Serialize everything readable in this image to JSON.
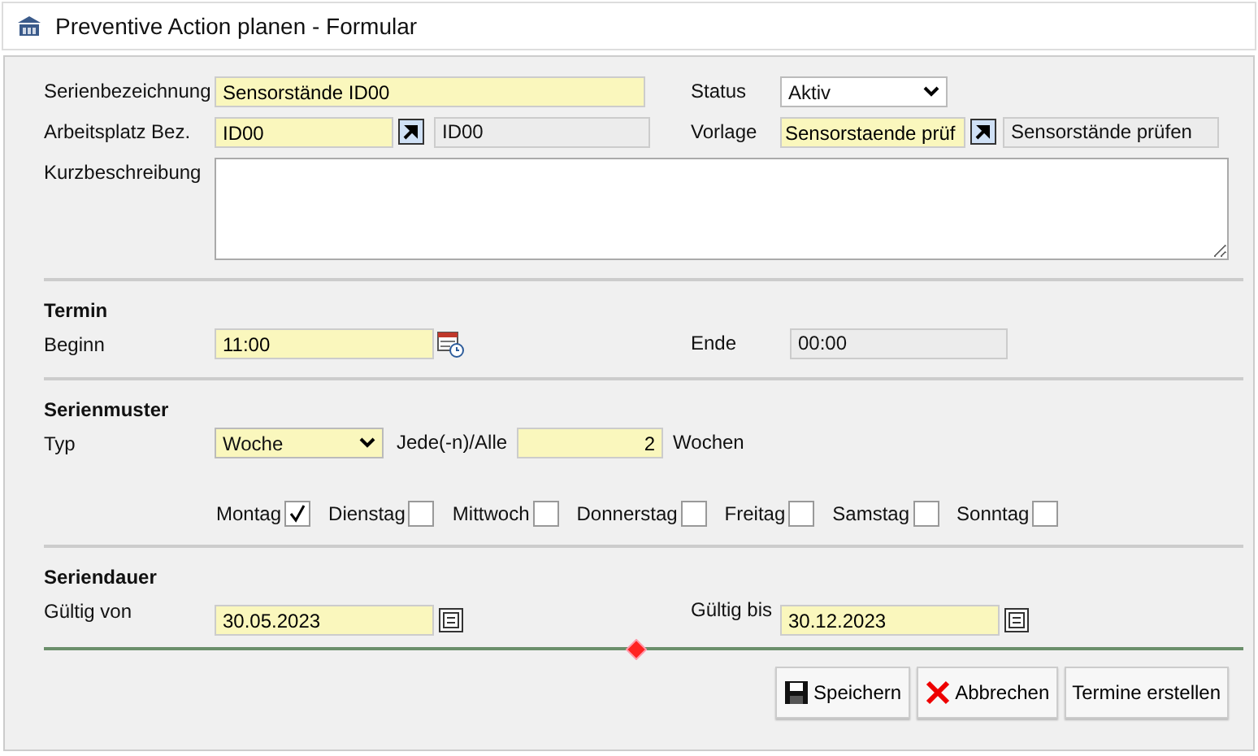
{
  "window": {
    "title": "Preventive Action planen - Formular"
  },
  "general": {
    "serienbezeichnung": {
      "label": "Serienbezeichnung",
      "value": "Sensorstände ID00"
    },
    "status": {
      "label": "Status",
      "value": "Aktiv"
    },
    "arbeitsplatz": {
      "label": "Arbeitsplatz Bez.",
      "value": "ID00",
      "description": "ID00"
    },
    "vorlage": {
      "label": "Vorlage",
      "value": "Sensorstaende prüf",
      "description": "Sensorstände prüfen"
    },
    "kurzbeschreibung": {
      "label": "Kurzbeschreibung"
    }
  },
  "termin": {
    "heading": "Termin",
    "beginn": {
      "label": "Beginn",
      "value": "11:00"
    },
    "ende": {
      "label": "Ende",
      "value": "00:00"
    }
  },
  "serienmuster": {
    "heading": "Serienmuster",
    "typ": {
      "label": "Typ",
      "value": "Woche"
    },
    "interval_label": "Jede(-n)/Alle",
    "interval": "2",
    "unit": "Wochen",
    "days": [
      {
        "label": "Montag",
        "checked": true
      },
      {
        "label": "Dienstag",
        "checked": false
      },
      {
        "label": "Mittwoch",
        "checked": false
      },
      {
        "label": "Donnerstag",
        "checked": false
      },
      {
        "label": "Freitag",
        "checked": false
      },
      {
        "label": "Samstag",
        "checked": false
      },
      {
        "label": "Sonntag",
        "checked": false
      }
    ]
  },
  "seriendauer": {
    "heading": "Seriendauer",
    "von": {
      "label": "Gültig von",
      "value": "30.05.2023"
    },
    "bis": {
      "label": "Gültig bis",
      "value": "30.12.2023"
    }
  },
  "buttons": [
    {
      "label": "Speichern",
      "kind": "save"
    },
    {
      "label": "Abbrechen",
      "kind": "cancel"
    },
    {
      "label": "Termine erstellen",
      "kind": "plain"
    }
  ]
}
